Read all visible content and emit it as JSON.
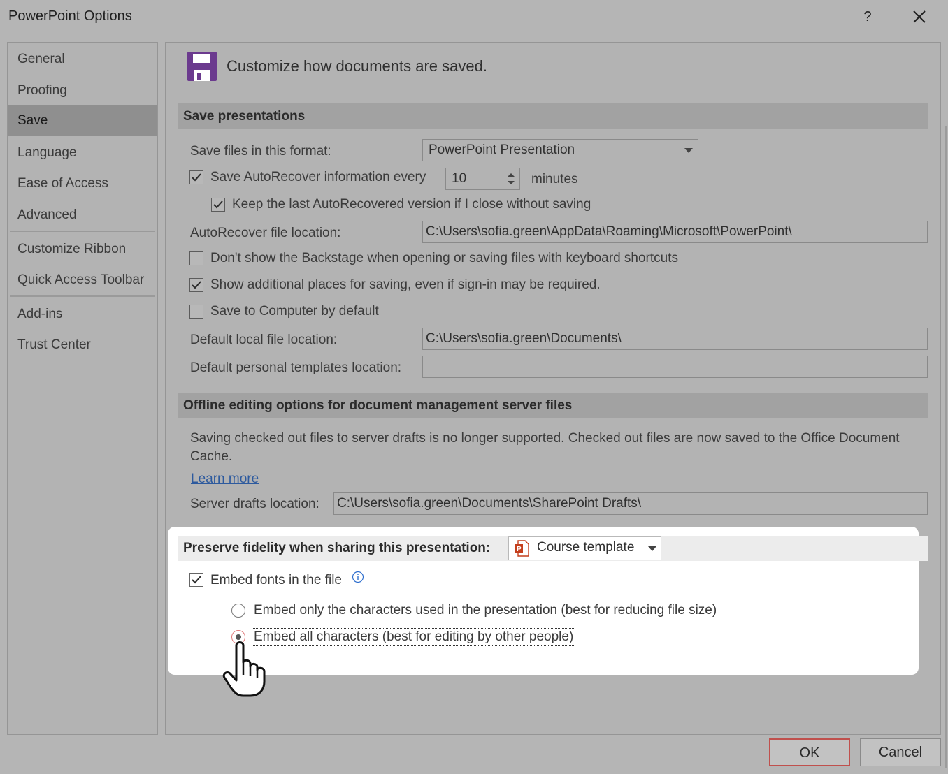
{
  "window": {
    "title": "PowerPoint Options",
    "help_label": "?"
  },
  "sidebar": {
    "items": [
      {
        "label": "General"
      },
      {
        "label": "Proofing"
      },
      {
        "label": "Save"
      },
      {
        "label": "Language"
      },
      {
        "label": "Ease of Access"
      },
      {
        "label": "Advanced"
      },
      {
        "label": "Customize Ribbon"
      },
      {
        "label": "Quick Access Toolbar"
      },
      {
        "label": "Add-ins"
      },
      {
        "label": "Trust Center"
      }
    ],
    "selected": "Save"
  },
  "main": {
    "heading": "Customize how documents are saved.",
    "heading_icon": "floppy-disk-icon",
    "accent_color": "#6b3a8e",
    "save_presentations": {
      "section_title": "Save presentations",
      "format_label": "Save files in this format:",
      "format_value": "PowerPoint Presentation",
      "autorecover_label": "Save AutoRecover information every",
      "autorecover_checked": true,
      "autorecover_minutes": "10",
      "minutes_label": "minutes",
      "keep_last_label": "Keep the last AutoRecovered version if I close without saving",
      "keep_last_checked": true,
      "autorecover_location_label": "AutoRecover file location:",
      "autorecover_location_value": "C:\\Users\\sofia.green\\AppData\\Roaming\\Microsoft\\PowerPoint\\",
      "backstage_label": "Don't show the Backstage when opening or saving files with keyboard shortcuts",
      "backstage_checked": false,
      "additional_places_label": "Show additional places for saving, even if sign-in may be required.",
      "additional_places_checked": true,
      "save_computer_label": "Save to Computer by default",
      "save_computer_checked": false,
      "default_local_label": "Default local file location:",
      "default_local_value": "C:\\Users\\sofia.green\\Documents\\",
      "templates_label": "Default personal templates location:",
      "templates_value": ""
    },
    "offline": {
      "section_title": "Offline editing options for document management server files",
      "description": "Saving checked out files to server drafts is no longer supported. Checked out files are now saved to the Office Document Cache.",
      "learn_more": "Learn more",
      "server_drafts_label": "Server drafts location:",
      "server_drafts_value": "C:\\Users\\sofia.green\\Documents\\SharePoint Drafts\\"
    },
    "fidelity": {
      "section_title": "Preserve fidelity when sharing this presentation:",
      "presentation_value": "Course template",
      "presentation_icon": "powerpoint-file-icon",
      "embed_fonts_label": "Embed fonts in the file",
      "embed_fonts_checked": true,
      "embed_only_label": "Embed only the characters used in the presentation (best for reducing file size)",
      "embed_all_label": "Embed all characters (best for editing by other people)",
      "selected_option": "embed_all"
    }
  },
  "footer": {
    "ok_label": "OK",
    "cancel_label": "Cancel",
    "ok_border_color": "#c0504d"
  }
}
